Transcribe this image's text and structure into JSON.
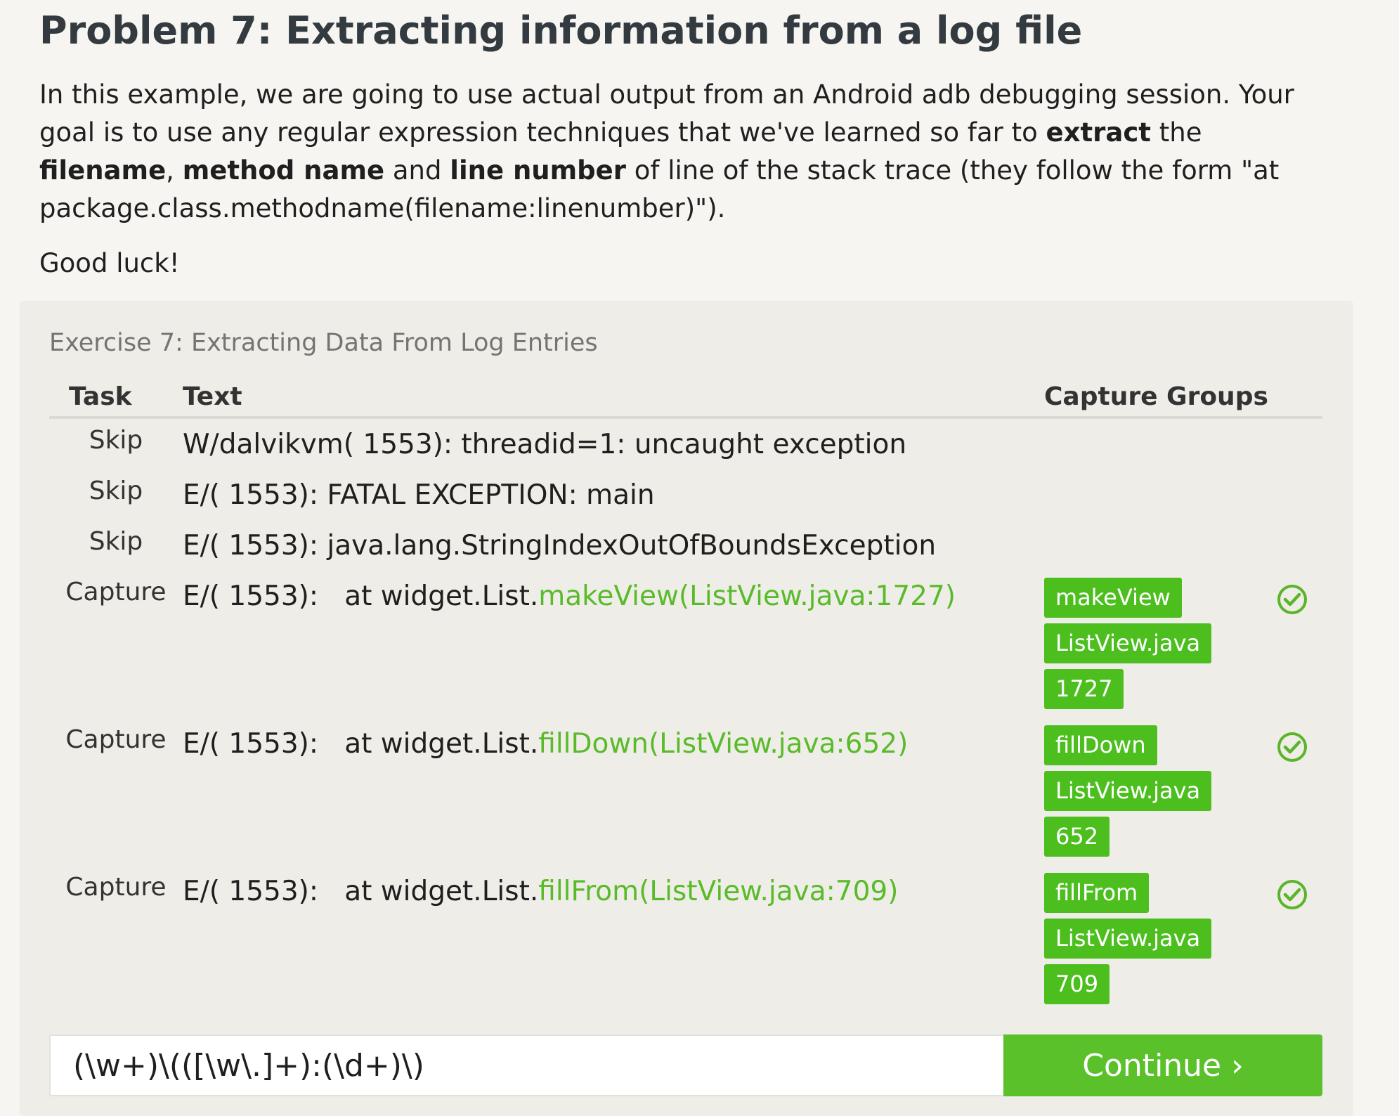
{
  "problem": {
    "title": "Problem 7: Extracting information from a log file",
    "intro_parts": [
      "In this example, we are going to use actual output from an Android adb debugging session. Your goal is to use any regular expression techniques that we've learned so far to ",
      "extract",
      " the ",
      "filename",
      ", ",
      "method name",
      " and ",
      "line number",
      " of line of the stack trace (they follow the form \"at package.class.methodname(filename:linenumber)\")."
    ],
    "good_luck": "Good luck!"
  },
  "exercise": {
    "title": "Exercise 7: Extracting Data From Log Entries",
    "headers": {
      "task": "Task",
      "text": "Text",
      "capture_groups": "Capture Groups"
    },
    "rows": [
      {
        "task": "Skip",
        "prefix": "W/dalvikvm( 1553): threadid=1: uncaught exception",
        "match": "",
        "groups": [],
        "matched": false
      },
      {
        "task": "Skip",
        "prefix": "E/( 1553): FATAL EXCEPTION: main",
        "match": "",
        "groups": [],
        "matched": false
      },
      {
        "task": "Skip",
        "prefix": "E/( 1553): java.lang.StringIndexOutOfBoundsException",
        "match": "",
        "groups": [],
        "matched": false
      },
      {
        "task": "Capture",
        "prefix": "E/( 1553):   at widget.List.",
        "match": "makeView(ListView.java:1727)",
        "groups": [
          "makeView",
          "ListView.java",
          "1727"
        ],
        "matched": true
      },
      {
        "task": "Capture",
        "prefix": "E/( 1553):   at widget.List.",
        "match": "fillDown(ListView.java:652)",
        "groups": [
          "fillDown",
          "ListView.java",
          "652"
        ],
        "matched": true
      },
      {
        "task": "Capture",
        "prefix": "E/( 1553):   at widget.List.",
        "match": "fillFrom(ListView.java:709)",
        "groups": [
          "fillFrom",
          "ListView.java",
          "709"
        ],
        "matched": true
      }
    ],
    "regex_value": "(\\w+)\\(([\\w\\.]+):(\\d+)\\)",
    "continue_label": "Continue ›"
  },
  "colors": {
    "match_text": "#5abb2a",
    "chip": "#4cbf1f",
    "button": "#5ac12a",
    "check": "#5ab52a"
  },
  "icons": {
    "matched": "check-circle-icon"
  }
}
